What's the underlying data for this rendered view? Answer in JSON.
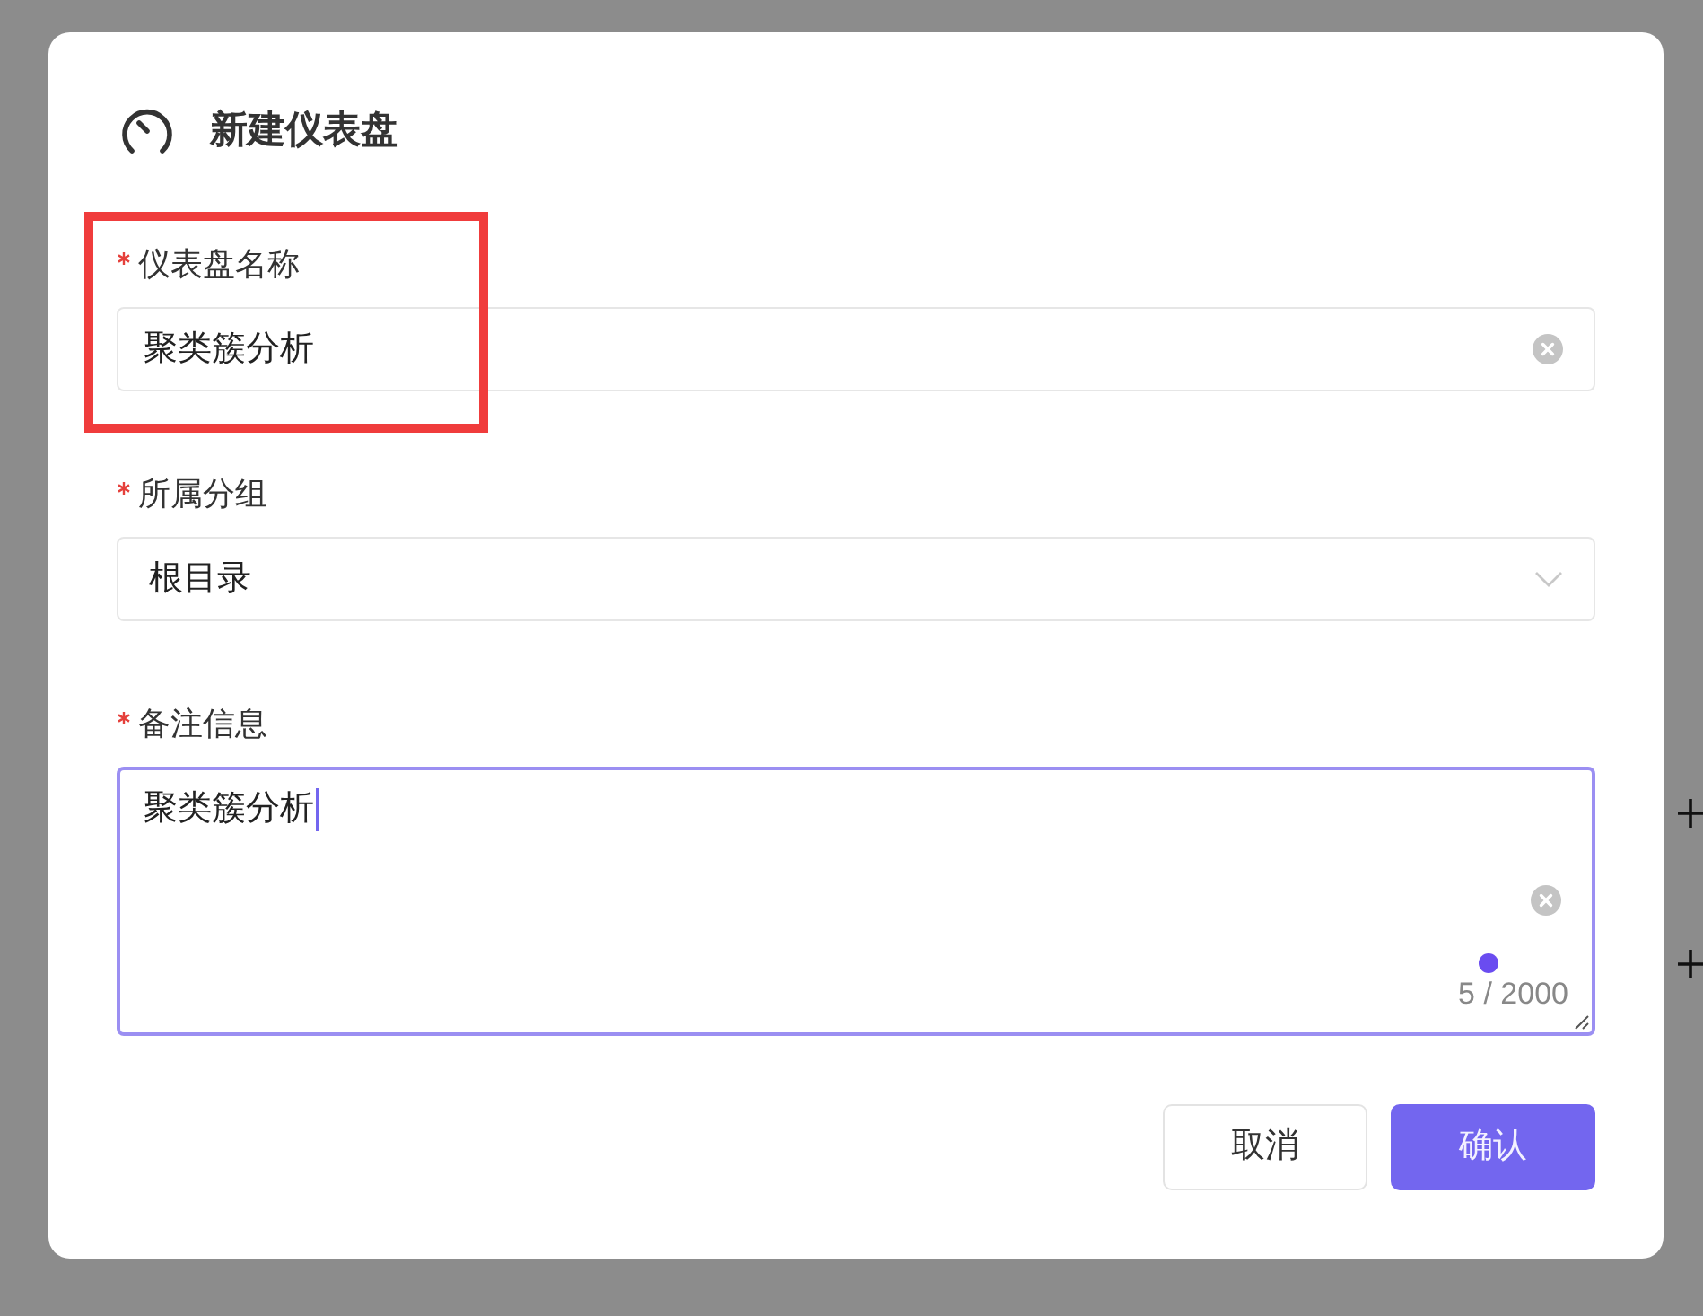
{
  "dialog": {
    "title": "新建仪表盘",
    "fields": [
      {
        "kind": "text",
        "label": "仪表盘名称",
        "required": true,
        "value": "聚类簇分析",
        "focused": false,
        "highlighted": true
      },
      {
        "kind": "select",
        "label": "所属分组",
        "required": true,
        "value": "根目录",
        "focused": false,
        "highlighted": false
      },
      {
        "kind": "textarea",
        "label": "备注信息",
        "required": true,
        "value": "聚类簇分析",
        "focused": true,
        "highlighted": false,
        "count": "5 / 2000"
      }
    ],
    "buttons": [
      {
        "label": "取消",
        "kind": "secondary"
      },
      {
        "label": "确认",
        "kind": "primary"
      }
    ]
  }
}
